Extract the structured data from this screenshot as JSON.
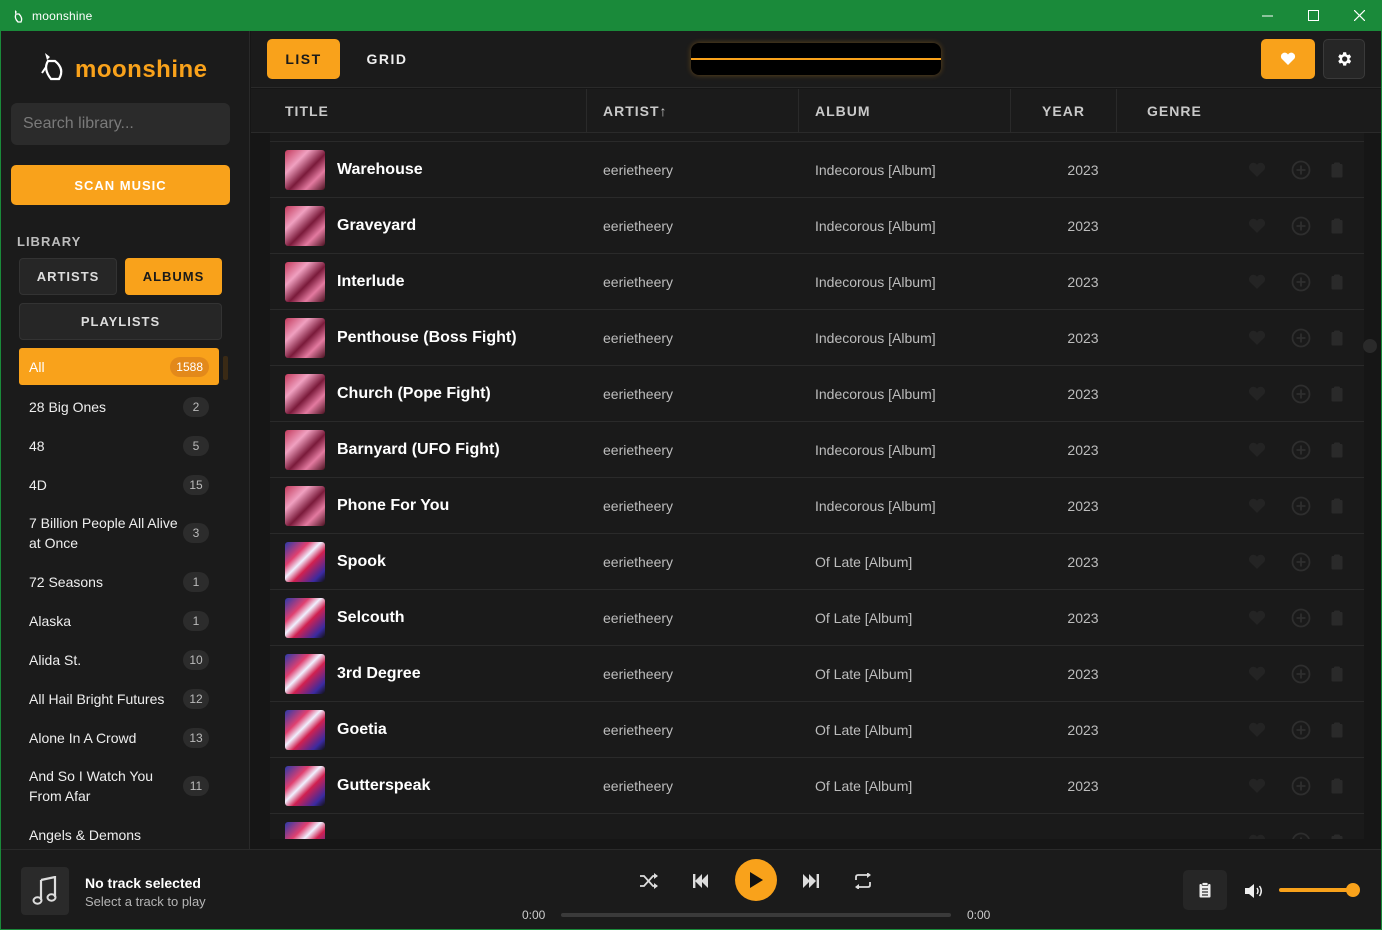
{
  "window": {
    "title": "moonshine"
  },
  "brand": {
    "name": "moonshine"
  },
  "search": {
    "placeholder": "Search library..."
  },
  "sidebar": {
    "scan_label": "SCAN MUSIC",
    "library_label": "LIBRARY",
    "tabs": {
      "artists": "ARTISTS",
      "albums": "ALBUMS",
      "playlists": "PLAYLISTS"
    },
    "albums": [
      {
        "name": "All",
        "count": "1588",
        "active": true
      },
      {
        "name": "28 Big Ones",
        "count": "2"
      },
      {
        "name": "48",
        "count": "5"
      },
      {
        "name": "4D",
        "count": "15"
      },
      {
        "name": "7 Billion People All Alive at Once",
        "count": "3"
      },
      {
        "name": "72 Seasons",
        "count": "1"
      },
      {
        "name": "Alaska",
        "count": "1"
      },
      {
        "name": "Alida St.",
        "count": "10"
      },
      {
        "name": "All Hail Bright Futures",
        "count": "12"
      },
      {
        "name": "Alone In A Crowd",
        "count": "13"
      },
      {
        "name": "And So I Watch You From Afar",
        "count": "11"
      },
      {
        "name": "Angels & Demons",
        "count": ""
      }
    ]
  },
  "toolbar": {
    "list_label": "LIST",
    "grid_label": "GRID"
  },
  "table": {
    "headers": {
      "title": "TITLE",
      "artist": "ARTIST↑",
      "album": "ALBUM",
      "year": "YEAR",
      "genre": "GENRE"
    },
    "rows": [
      {
        "title": "Warehouse",
        "artist": "eerietheery",
        "album": "Indecorous [Album]",
        "year": "2023",
        "art": "a"
      },
      {
        "title": "Graveyard",
        "artist": "eerietheery",
        "album": "Indecorous [Album]",
        "year": "2023",
        "art": "a"
      },
      {
        "title": "Interlude",
        "artist": "eerietheery",
        "album": "Indecorous [Album]",
        "year": "2023",
        "art": "a"
      },
      {
        "title": "Penthouse (Boss Fight)",
        "artist": "eerietheery",
        "album": "Indecorous [Album]",
        "year": "2023",
        "art": "a"
      },
      {
        "title": "Church (Pope Fight)",
        "artist": "eerietheery",
        "album": "Indecorous [Album]",
        "year": "2023",
        "art": "a"
      },
      {
        "title": "Barnyard (UFO Fight)",
        "artist": "eerietheery",
        "album": "Indecorous [Album]",
        "year": "2023",
        "art": "a"
      },
      {
        "title": "Phone For You",
        "artist": "eerietheery",
        "album": "Indecorous [Album]",
        "year": "2023",
        "art": "a"
      },
      {
        "title": "Spook",
        "artist": "eerietheery",
        "album": "Of Late [Album]",
        "year": "2023",
        "art": "b"
      },
      {
        "title": "Selcouth",
        "artist": "eerietheery",
        "album": "Of Late [Album]",
        "year": "2023",
        "art": "b"
      },
      {
        "title": "3rd Degree",
        "artist": "eerietheery",
        "album": "Of Late [Album]",
        "year": "2023",
        "art": "b"
      },
      {
        "title": "Goetia",
        "artist": "eerietheery",
        "album": "Of Late [Album]",
        "year": "2023",
        "art": "b"
      },
      {
        "title": "Gutterspeak",
        "artist": "eerietheery",
        "album": "Of Late [Album]",
        "year": "2023",
        "art": "b"
      },
      {
        "title": "",
        "artist": "",
        "album": "",
        "year": "",
        "art": "b"
      }
    ]
  },
  "player": {
    "track_title": "No track selected",
    "track_sub": "Select a track to play",
    "time_current": "0:00",
    "time_total": "0:00",
    "progress": 0,
    "volume": 1.0
  },
  "colors": {
    "accent": "#f9a21b",
    "titlebar": "#1a8a3a",
    "background": "#161616"
  }
}
